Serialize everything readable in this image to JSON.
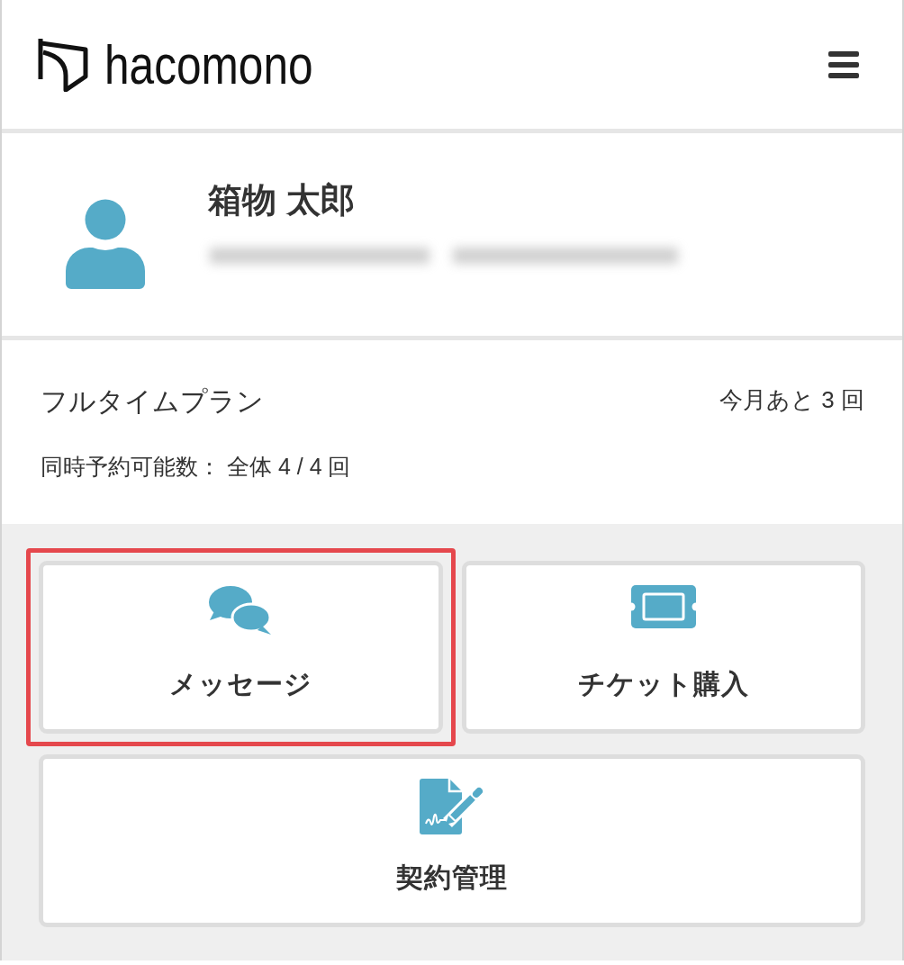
{
  "header": {
    "logo": "hacomono"
  },
  "profile": {
    "name": "箱物 太郎"
  },
  "plan": {
    "name": "フルタイムプラン",
    "remaining": "今月あと 3 回",
    "concurrent_limit": "同時予約可能数： 全体 4 / 4 回"
  },
  "menu": [
    {
      "kind": "message",
      "label": "メッセージ",
      "highlighted": true
    },
    {
      "kind": "ticket",
      "label": "チケット購入",
      "highlighted": false
    },
    {
      "kind": "contract",
      "label": "契約管理",
      "highlighted": false
    }
  ]
}
